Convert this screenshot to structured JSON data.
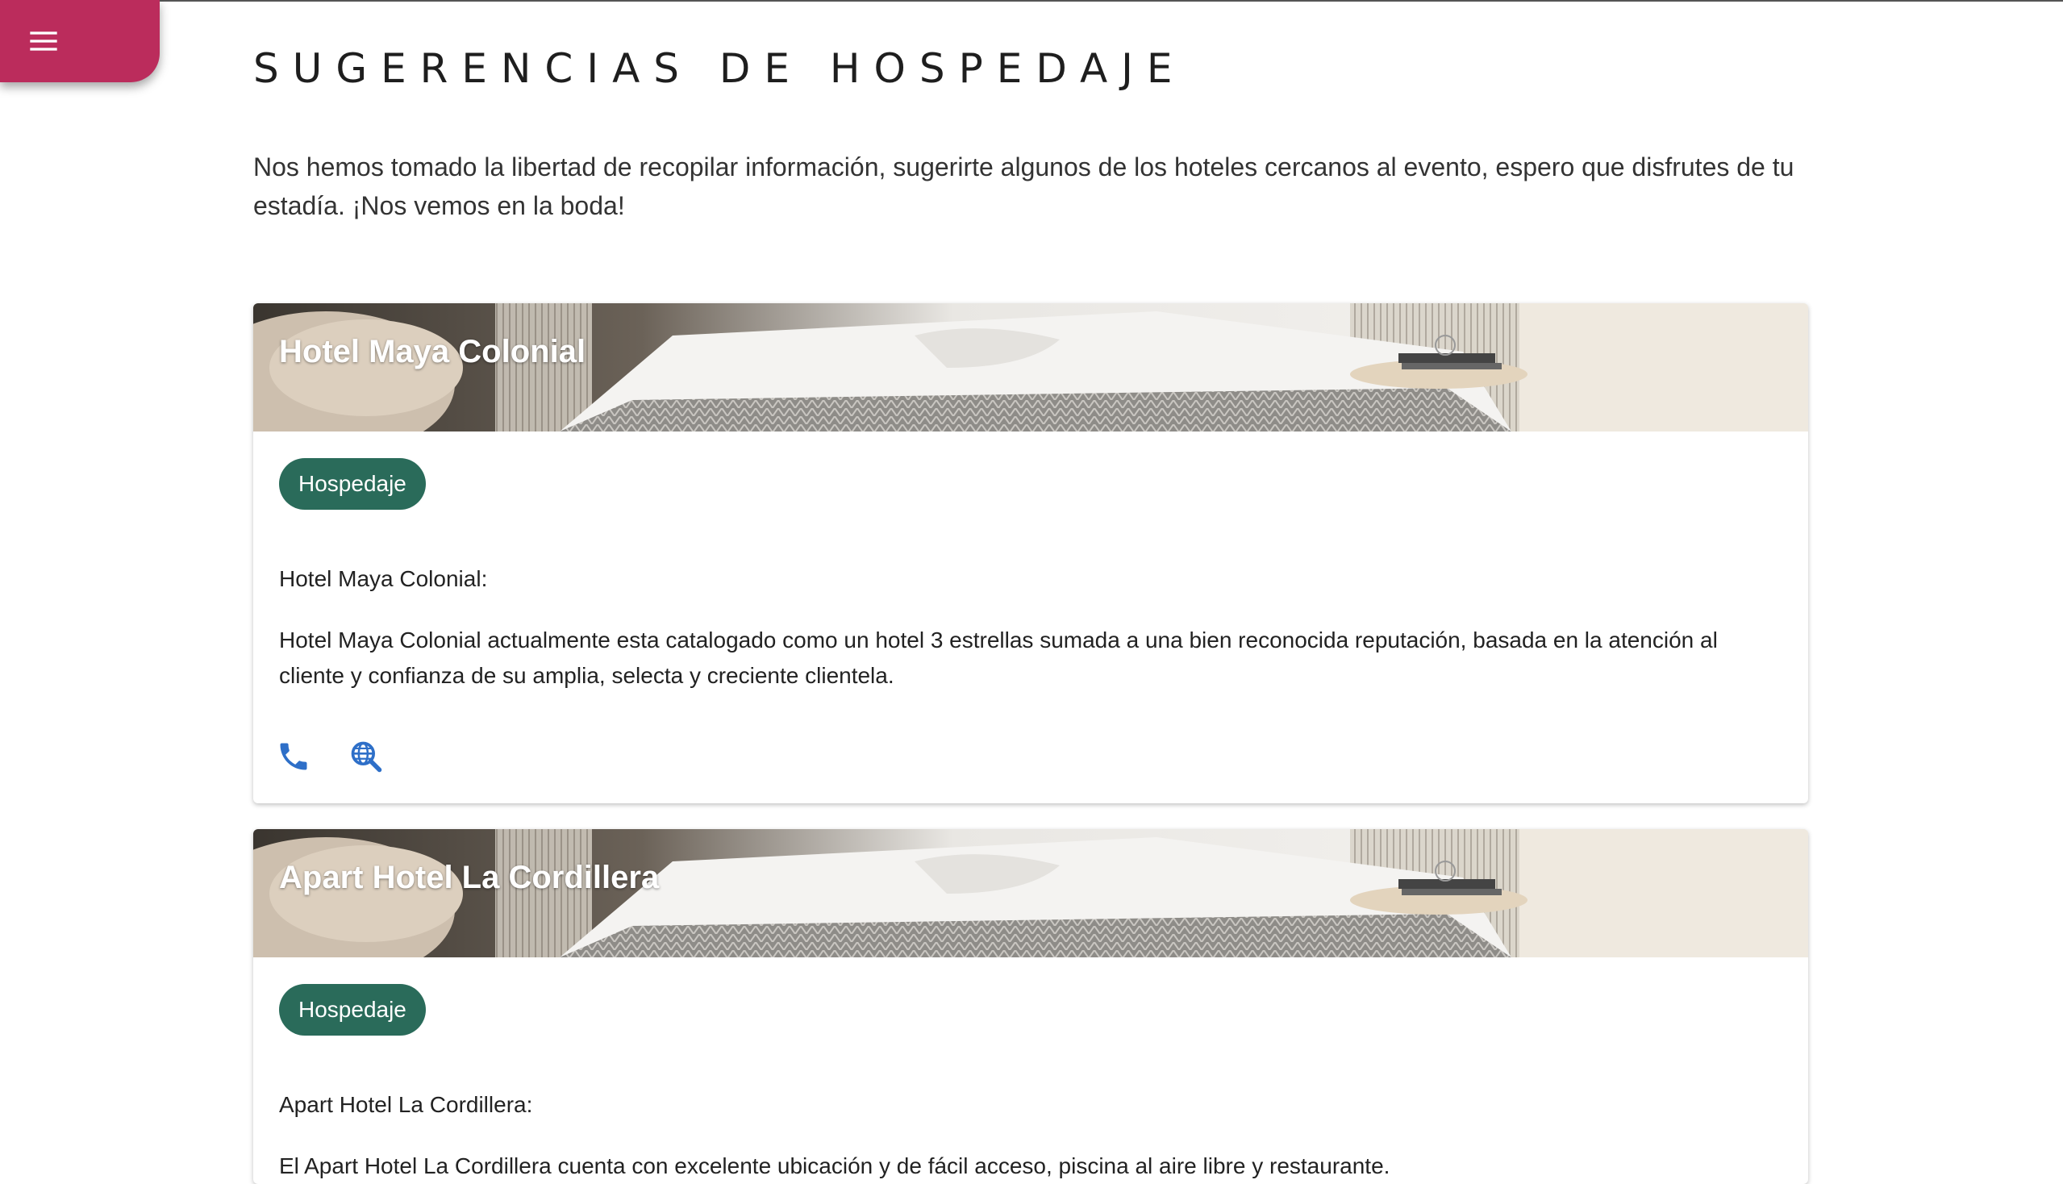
{
  "app": {
    "accent": "#bb2c5c",
    "chip_color": "#2a6b5a",
    "icon_color": "#2e6fc8"
  },
  "menu": {
    "icon": "hamburger-menu-icon"
  },
  "page": {
    "title": "SUGERENCIAS DE HOSPEDAJE",
    "intro": "Nos hemos tomado la libertad de recopilar información, sugerirte algunos de los hoteles cercanos al evento, espero que disfrutes de tu estadía. ¡Nos vemos en la boda!"
  },
  "hotels": [
    {
      "name": "Hotel Maya Colonial",
      "chip": "Hospedaje",
      "subtitle": "Hotel Maya Colonial:",
      "description": "Hotel Maya Colonial actualmente esta catalogado como un hotel 3 estrellas sumada a una bien reconocida reputación, basada en la atención al cliente y confianza de su amplia, selecta y creciente clientela.",
      "actions": [
        "phone-icon",
        "web-search-icon"
      ]
    },
    {
      "name": "Apart Hotel La Cordillera",
      "chip": "Hospedaje",
      "subtitle": "Apart Hotel La Cordillera:",
      "description": "El Apart Hotel La Cordillera cuenta con excelente ubicación y de fácil acceso, piscina al aire libre y restaurante."
    }
  ]
}
